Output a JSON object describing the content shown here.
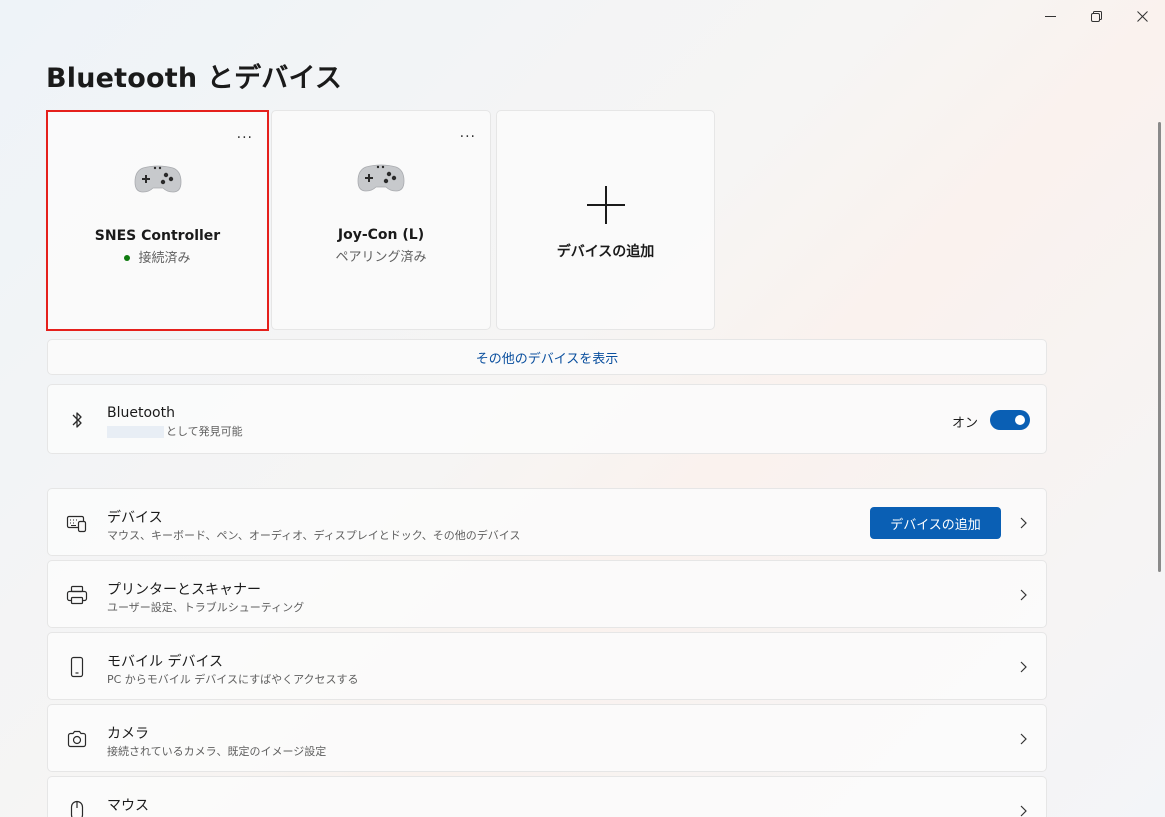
{
  "window": {
    "title": "Bluetooth とデバイス"
  },
  "devices": [
    {
      "name": "SNES Controller",
      "status": "接続済み",
      "more": "...",
      "icon": "gamepad-icon",
      "connected": true
    },
    {
      "name": "Joy-Con (L)",
      "status": "ペアリング済み",
      "more": "...",
      "icon": "gamepad-icon",
      "connected": false
    }
  ],
  "add_device_card": {
    "label": "デバイスの追加",
    "icon": "plus-icon"
  },
  "show_more": {
    "label": "その他のデバイスを表示"
  },
  "bluetooth": {
    "title": "Bluetooth",
    "subtitle": "として発見可能",
    "toggle_label": "オン",
    "toggle_on": true,
    "icon": "bluetooth-icon"
  },
  "settings": [
    {
      "title": "デバイス",
      "subtitle": "マウス、キーボード、ペン、オーディオ、ディスプレイとドック、その他のデバイス",
      "icon": "keyboard-icon",
      "button": "デバイスの追加"
    },
    {
      "title": "プリンターとスキャナー",
      "subtitle": "ユーザー設定、トラブルシューティング",
      "icon": "printer-icon"
    },
    {
      "title": "モバイル デバイス",
      "subtitle": "PC からモバイル デバイスにすばやくアクセスする",
      "icon": "phone-icon"
    },
    {
      "title": "カメラ",
      "subtitle": "接続されているカメラ、既定のイメージ設定",
      "icon": "camera-icon"
    },
    {
      "title": "マウス",
      "subtitle": "",
      "icon": "mouse-icon"
    }
  ],
  "colors": {
    "accent": "#0a5fb4",
    "selection": "#e5201c",
    "connected": "#0f7b0f",
    "link": "#0a4f9e"
  }
}
